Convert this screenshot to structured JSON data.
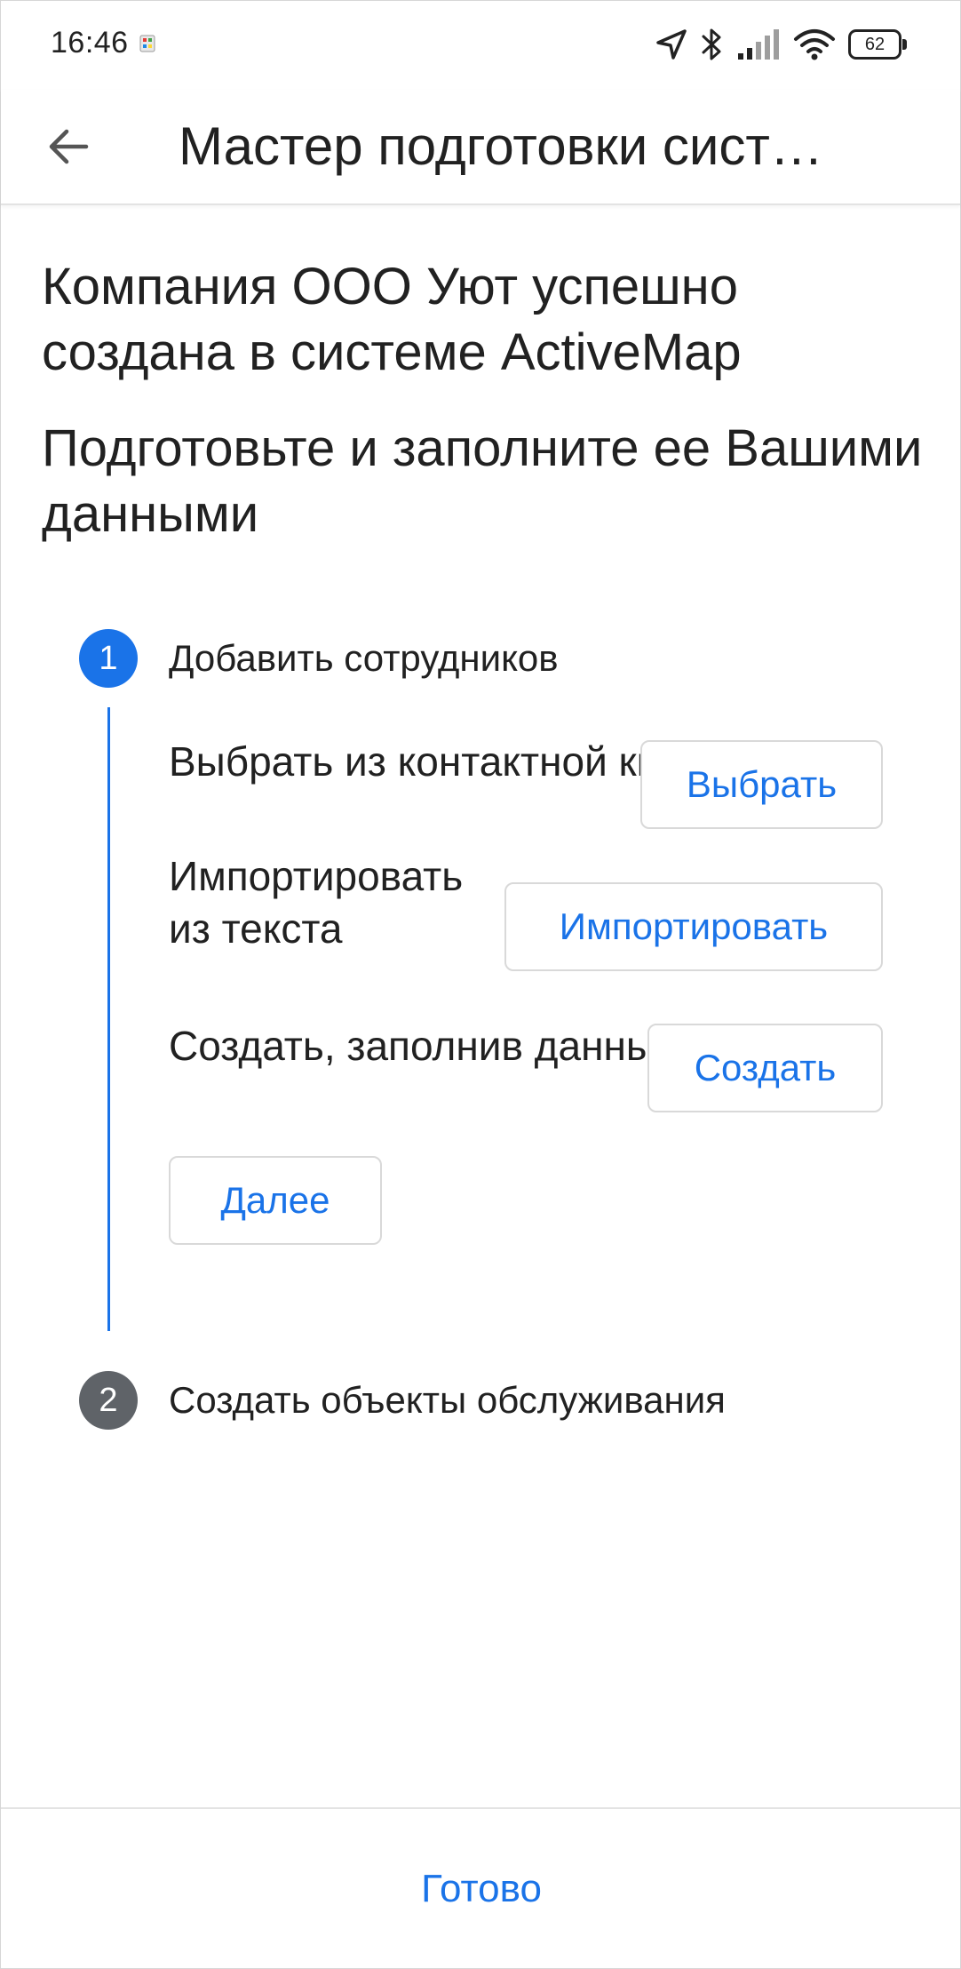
{
  "status_bar": {
    "time": "16:46",
    "battery": "62",
    "icons": [
      "location-arrow-icon",
      "bluetooth-icon",
      "signal-icon",
      "wifi-icon",
      "battery-icon"
    ]
  },
  "app_bar": {
    "back_icon": "arrow-back-icon",
    "title": "Мастер подготовки сист…"
  },
  "content": {
    "headline_1": "Компания ООО Уют успешно создана в системе ActiveMap",
    "headline_2": "Подготовьте и заполните ее Вашими данными"
  },
  "steps": [
    {
      "number": "1",
      "title": "Добавить сотрудников",
      "options": [
        {
          "text": "Выбрать из контактной книги",
          "button": "Выбрать"
        },
        {
          "text": "Импортировать из текста",
          "button": "Импортировать"
        },
        {
          "text": "Создать, заполнив данные вручную",
          "button": "Создать"
        }
      ],
      "next_button": "Далее"
    },
    {
      "number": "2",
      "title": "Создать объекты обслуживания"
    }
  ],
  "footer": {
    "done_button": "Готово"
  },
  "colors": {
    "accent": "#1a73e8",
    "inactive_step": "#5f6368",
    "text": "#212121",
    "divider": "#e3e3e3"
  }
}
